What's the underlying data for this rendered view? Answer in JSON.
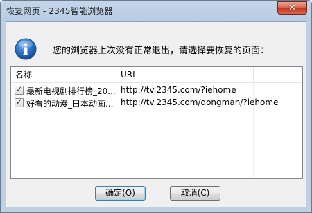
{
  "window": {
    "title": "恢复网页 - 2345智能浏览器",
    "close_symbol": "✕"
  },
  "dialog": {
    "prompt": "您的浏览器上次没有正常退出，请选择要恢复的页面：",
    "icon": "info-icon"
  },
  "list": {
    "columns": [
      "名称",
      "URL",
      ""
    ],
    "rows": [
      {
        "checked": true,
        "name": "最新电视剧排行榜_20...",
        "url": "http://tv.2345.com/?iehome"
      },
      {
        "checked": true,
        "name": "好看的动漫_日本动画...",
        "url": "http://tv.2345.com/dongman/?iehome"
      }
    ]
  },
  "buttons": {
    "ok_label": "确定(O)",
    "cancel_label": "取消(C)"
  },
  "colors": {
    "title_bar": "#b9cde4",
    "close_button": "#c5381c",
    "info_icon": "#2b6fc2"
  }
}
